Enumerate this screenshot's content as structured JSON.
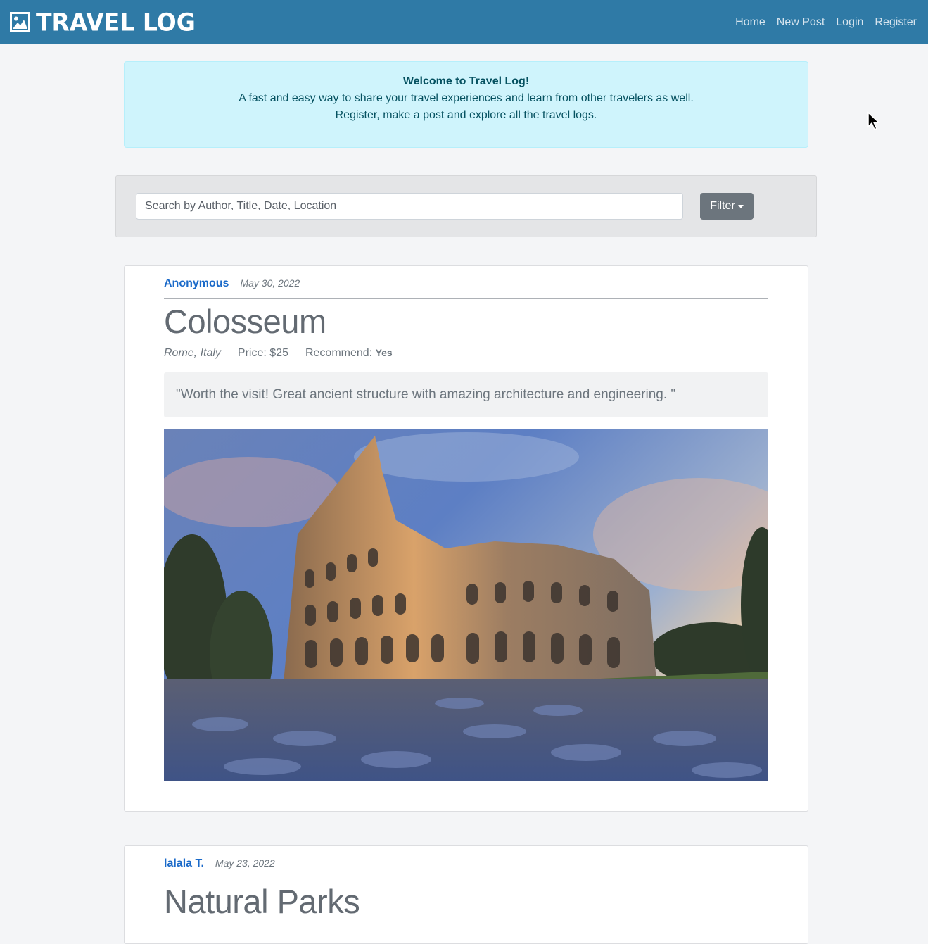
{
  "navbar": {
    "brand": "TRAVEL LOG",
    "links": [
      "Home",
      "New Post",
      "Login",
      "Register"
    ]
  },
  "welcome": {
    "title": "Welcome to Travel Log!",
    "line1": "A fast and easy way to share your travel experiences and learn from other travelers as well.",
    "line2": "Register, make a post and explore all the travel logs."
  },
  "search": {
    "placeholder": "Search by Author, Title, Date, Location",
    "filter_label": "Filter"
  },
  "posts": [
    {
      "author": "Anonymous",
      "date": "May 30, 2022",
      "title": "Colosseum",
      "location": "Rome, Italy",
      "price_label": "Price: $25",
      "recommend_label": "Recommend:",
      "recommend_value": "Yes",
      "quote": "\"Worth the visit! Great ancient structure with amazing architecture and engineering. \""
    },
    {
      "author": "lalala T.",
      "date": "May 23, 2022",
      "title": "Natural Parks"
    }
  ],
  "colors": {
    "navbar": "#2f7aa6",
    "alert_bg": "#cff4fc",
    "alert_text": "#055160",
    "author_link": "#1b6ac9",
    "filter_button": "#6c757d"
  }
}
